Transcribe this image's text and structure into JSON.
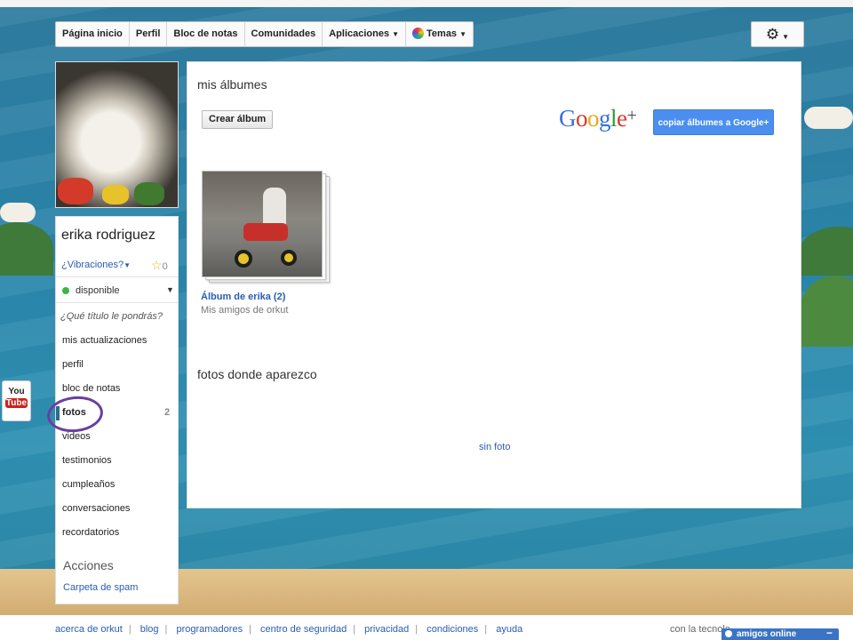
{
  "nav": {
    "items": [
      {
        "label": "Página inicio"
      },
      {
        "label": "Perfil"
      },
      {
        "label": "Bloc de notas"
      },
      {
        "label": "Comunidades"
      },
      {
        "label": "Aplicaciones"
      },
      {
        "label": "Temas"
      }
    ],
    "settings_icon": "gear-icon"
  },
  "profile": {
    "name": "erika rodriguez",
    "vibe_label": "¿Vibraciones?",
    "vibe_count": "0",
    "status": "disponible",
    "title_prompt": "¿Qué título le pondrás?"
  },
  "menu": {
    "items": [
      {
        "label": "mis actualizaciones"
      },
      {
        "label": "perfil"
      },
      {
        "label": "bloc de notas"
      },
      {
        "label": "fotos",
        "count": "2"
      },
      {
        "label": "videos"
      },
      {
        "label": "testimonios"
      },
      {
        "label": "cumpleaños"
      },
      {
        "label": "conversaciones"
      },
      {
        "label": "recordatorios"
      }
    ],
    "actions_heading": "Acciones",
    "spam_link": "Carpeta de spam"
  },
  "main": {
    "albums_title": "mis álbumes",
    "create_album": "Crear álbum",
    "gplus_logo": "Google+",
    "copy_button": "copiar álbumes a Google+",
    "album": {
      "title": "Álbum de erika (2)",
      "subtitle": "Mis amigos de orkut"
    },
    "tagged_title": "fotos donde aparezco",
    "no_photo": "sin foto"
  },
  "footer": {
    "links": [
      "acerca de orkut",
      "blog",
      "programadores",
      "centro de seguridad",
      "privacidad",
      "condiciones",
      "ayuda"
    ],
    "tech_text": "con la tecnolo",
    "amigos_online": "amigos online",
    "minimize": "−"
  },
  "side_badge": {
    "line1": "You",
    "line2": "Tube"
  },
  "colors": {
    "link": "#2a5db0",
    "copy_button": "#4b8ef0",
    "status_available": "#39b54a",
    "highlight_ring": "#6a3fa0"
  }
}
